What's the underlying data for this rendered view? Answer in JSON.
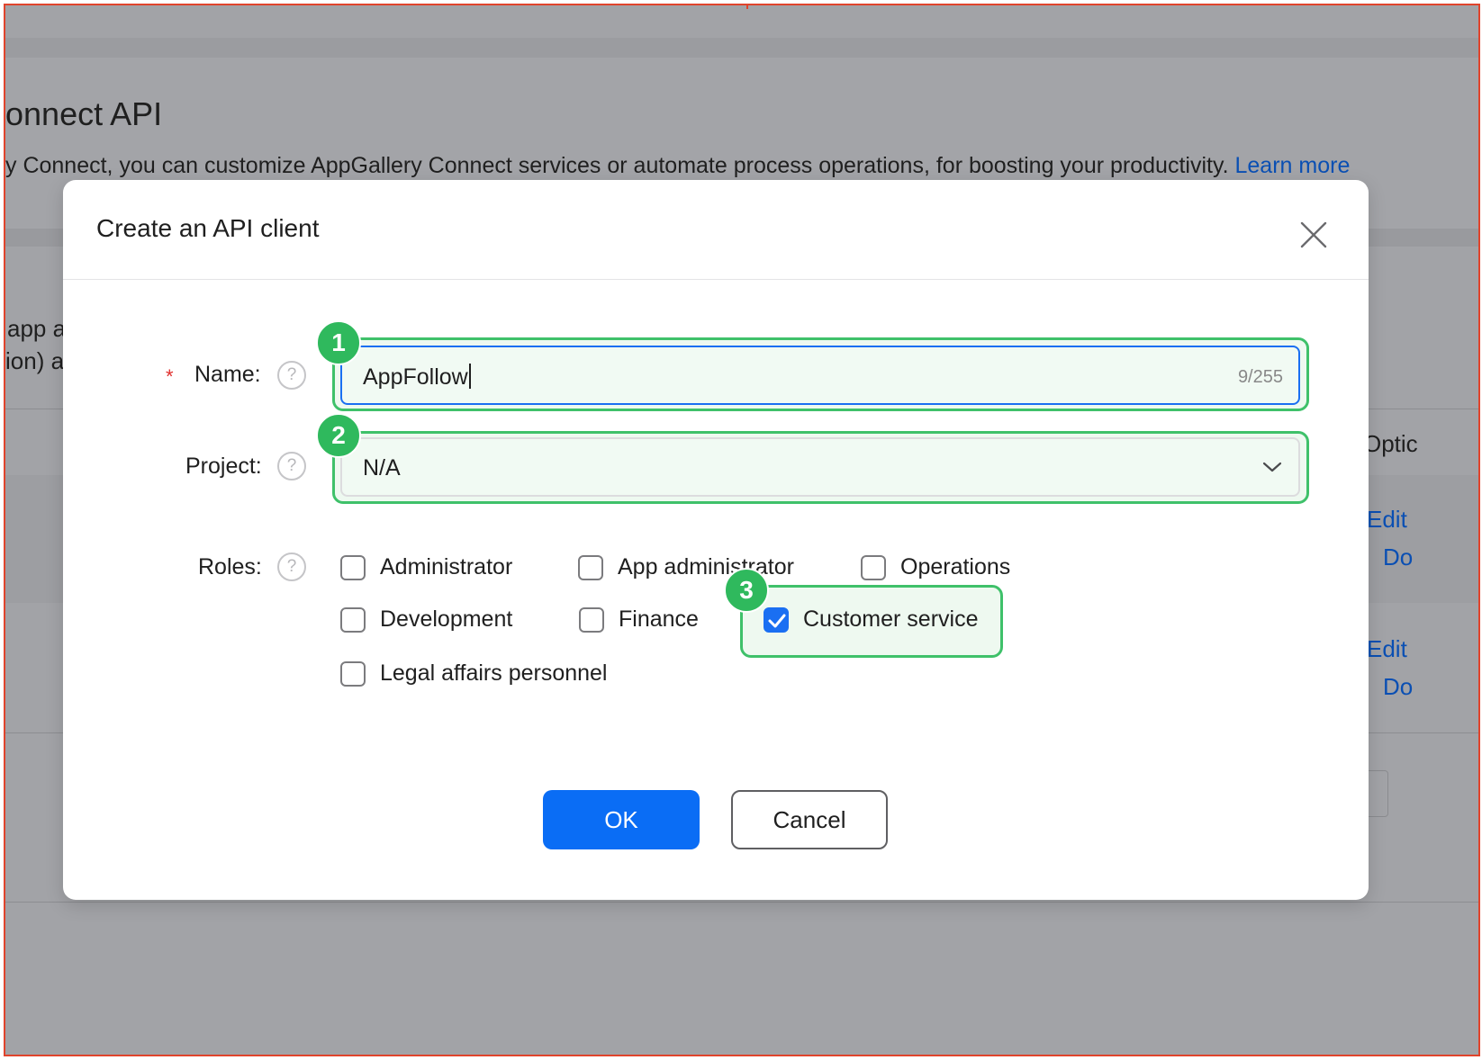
{
  "background": {
    "page_title": "onnect API",
    "description": "y Connect, you can customize AppGallery Connect services or automate process operations, for boosting your productivity.",
    "learn_more": "Learn more",
    "left_snippet_1": "app a",
    "left_snippet_2": "ion) a",
    "column_header": "Optic",
    "row1_edit": "Edit",
    "row1_do": "Do",
    "row2_edit": "Edit",
    "row2_do": "Do"
  },
  "dialog": {
    "title": "Create an API client",
    "name": {
      "required_mark": "*",
      "label": "Name:",
      "value": "AppFollow",
      "counter": "9/255",
      "badge": "1"
    },
    "project": {
      "label": "Project:",
      "value": "N/A",
      "badge": "2"
    },
    "roles": {
      "label": "Roles:",
      "badge": "3",
      "options": [
        {
          "label": "Administrator",
          "checked": false
        },
        {
          "label": "App administrator",
          "checked": false
        },
        {
          "label": "Operations",
          "checked": false
        },
        {
          "label": "Development",
          "checked": false
        },
        {
          "label": "Finance",
          "checked": false
        },
        {
          "label": "Customer service",
          "checked": true
        },
        {
          "label": "Legal affairs personnel",
          "checked": false
        }
      ]
    },
    "help_glyph": "?",
    "ok_label": "OK",
    "cancel_label": "Cancel"
  },
  "colors": {
    "primary": "#0a6df5",
    "highlight": "#3fc16a",
    "required": "#e0302d"
  }
}
